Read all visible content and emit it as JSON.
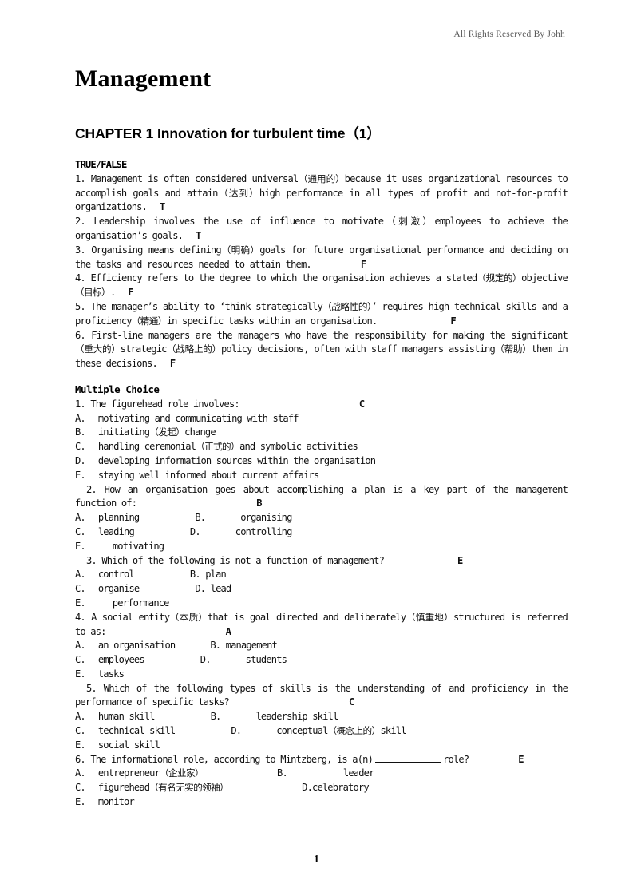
{
  "header": {
    "rights_text": "All Rights Reserved By Johh"
  },
  "title": "Management",
  "chapter_title": "CHAPTER 1 Innovation for turbulent time（1）",
  "sections": {
    "true_false": {
      "heading": "TRUE/FALSE",
      "items": [
        {
          "number": "1.",
          "text_a": "Management is often considered universal",
          "cjk_a": "（通用的）",
          "text_b": "because it uses organizational resources to accomplish goals and attain",
          "cjk_b": "（达到）",
          "text_c": "high performance in all types of profit and not-for-profit organizations.",
          "answer": "T"
        },
        {
          "number": "2.",
          "text_a": "Leadership involves the use of influence to motivate",
          "cjk_a": "（刺激）",
          "text_b": "employees to achieve the organisation’s goals.",
          "answer": "T"
        },
        {
          "number": "3.",
          "text_a": "Organising means defining",
          "cjk_a": "（明确）",
          "text_b": "goals for future organisational performance and deciding on the tasks and resources needed to attain them.",
          "answer": "F"
        },
        {
          "number": "4.",
          "text_a": "Efficiency refers to the degree to which the organisation achieves a stated",
          "cjk_a": "（规定的）",
          "text_b": "objective",
          "cjk_b": "（目标）",
          "text_c": ".",
          "answer": "F"
        },
        {
          "number": "5.",
          "text_a": "The manager’s ability to ‘think strategically",
          "cjk_a": "（战略性的）",
          "text_b": "’ requires high technical skills and a proficiency",
          "cjk_b": "（精通）",
          "text_c": "in specific tasks within an organisation.",
          "answer": "F"
        },
        {
          "number": "6.",
          "text_a": "First-line managers are the managers who have the responsibility for making the significant",
          "cjk_a": "（重大的）",
          "text_b": "strategic",
          "cjk_b": "（战略上的）",
          "text_c": "policy decisions, often with staff managers assisting",
          "cjk_c": "（帮助）",
          "text_d": "them in these decisions.",
          "answer": "F"
        }
      ]
    },
    "multiple_choice": {
      "heading": "Multiple Choice",
      "items": [
        {
          "number": "1.",
          "stem": "The figurehead role involves:",
          "answer": "C",
          "options": [
            {
              "letter": "A.",
              "text": "motivating and communicating with staff"
            },
            {
              "letter": "B.",
              "text": "initiating",
              "cjk": "（发起）",
              "text2": "change"
            },
            {
              "letter": "C.",
              "text": "handling ceremonial",
              "cjk": "（正式的）",
              "text2": "and symbolic activities"
            },
            {
              "letter": "D.",
              "text": "developing information sources within the organisation"
            },
            {
              "letter": "E.",
              "text": "staying well informed about current affairs"
            }
          ]
        },
        {
          "number": "2.",
          "stem": "How an organisation goes about accomplishing a plan is a key part of the management function of:",
          "answer": "B",
          "options_pairs": [
            {
              "l1": "A.",
              "t1": "planning",
              "l2": "B.",
              "t2": "organising"
            },
            {
              "l1": "C.",
              "t1": "leading",
              "l2": "D.",
              "t2": "controlling"
            }
          ],
          "option_last": {
            "letter": "E.",
            "text": "motivating"
          }
        },
        {
          "number": "3.",
          "stem": "Which of the following is not a function of management?",
          "answer": "E",
          "options_pairs": [
            {
              "l1": "A.",
              "t1": "control",
              "l2": "B.",
              "t2": "plan"
            },
            {
              "l1": "C.",
              "t1": "organise",
              "l2": "D.",
              "t2": "lead"
            }
          ],
          "option_last": {
            "letter": "E.",
            "text": "performance"
          }
        },
        {
          "number": "4.",
          "stem_a": "A social entity",
          "cjk_a": "（本质）",
          "stem_b": "that is goal directed and deliberately",
          "cjk_b": "（慎重地）",
          "stem_c": "structured is referred to as:",
          "answer": "A",
          "options_pairs": [
            {
              "l1": "A.",
              "t1": "an organisation",
              "l2": "B.",
              "t2": "management"
            },
            {
              "l1": "C.",
              "t1": "employees",
              "l2": "D.",
              "t2": "students"
            }
          ],
          "option_last": {
            "letter": "E.",
            "text": "tasks"
          }
        },
        {
          "number": "5.",
          "stem": "Which of the following types of skills is the understanding of and proficiency in the performance of specific tasks?",
          "answer": "C",
          "options_pairs": [
            {
              "l1": "A.",
              "t1": "human skill",
              "l2": "B.",
              "t2": "leadership skill"
            },
            {
              "l1": "C.",
              "t1": "technical skill",
              "l2": "D.",
              "t2": "conceptual",
              "cjk2": "（概念上的）",
              "t2b": "skill"
            }
          ],
          "option_last": {
            "letter": "E.",
            "text": "social skill"
          }
        },
        {
          "number": "6.",
          "stem_a": "The informational role, according to Mintzberg, is a(n)",
          "stem_b": "role?",
          "answer": "E",
          "options_pairs": [
            {
              "l1": "A.",
              "t1": "entrepreneur",
              "cjk1": "（企业家）",
              "l2": "B.",
              "t2": "leader"
            },
            {
              "l1": "C.",
              "t1": "figurehead",
              "cjk1": "（有名无实的领袖）",
              "l2": "D.",
              "t2": "celebratory"
            }
          ],
          "option_last": {
            "letter": "E.",
            "text": "monitor"
          }
        }
      ]
    }
  },
  "footer": {
    "page_number": "1"
  }
}
